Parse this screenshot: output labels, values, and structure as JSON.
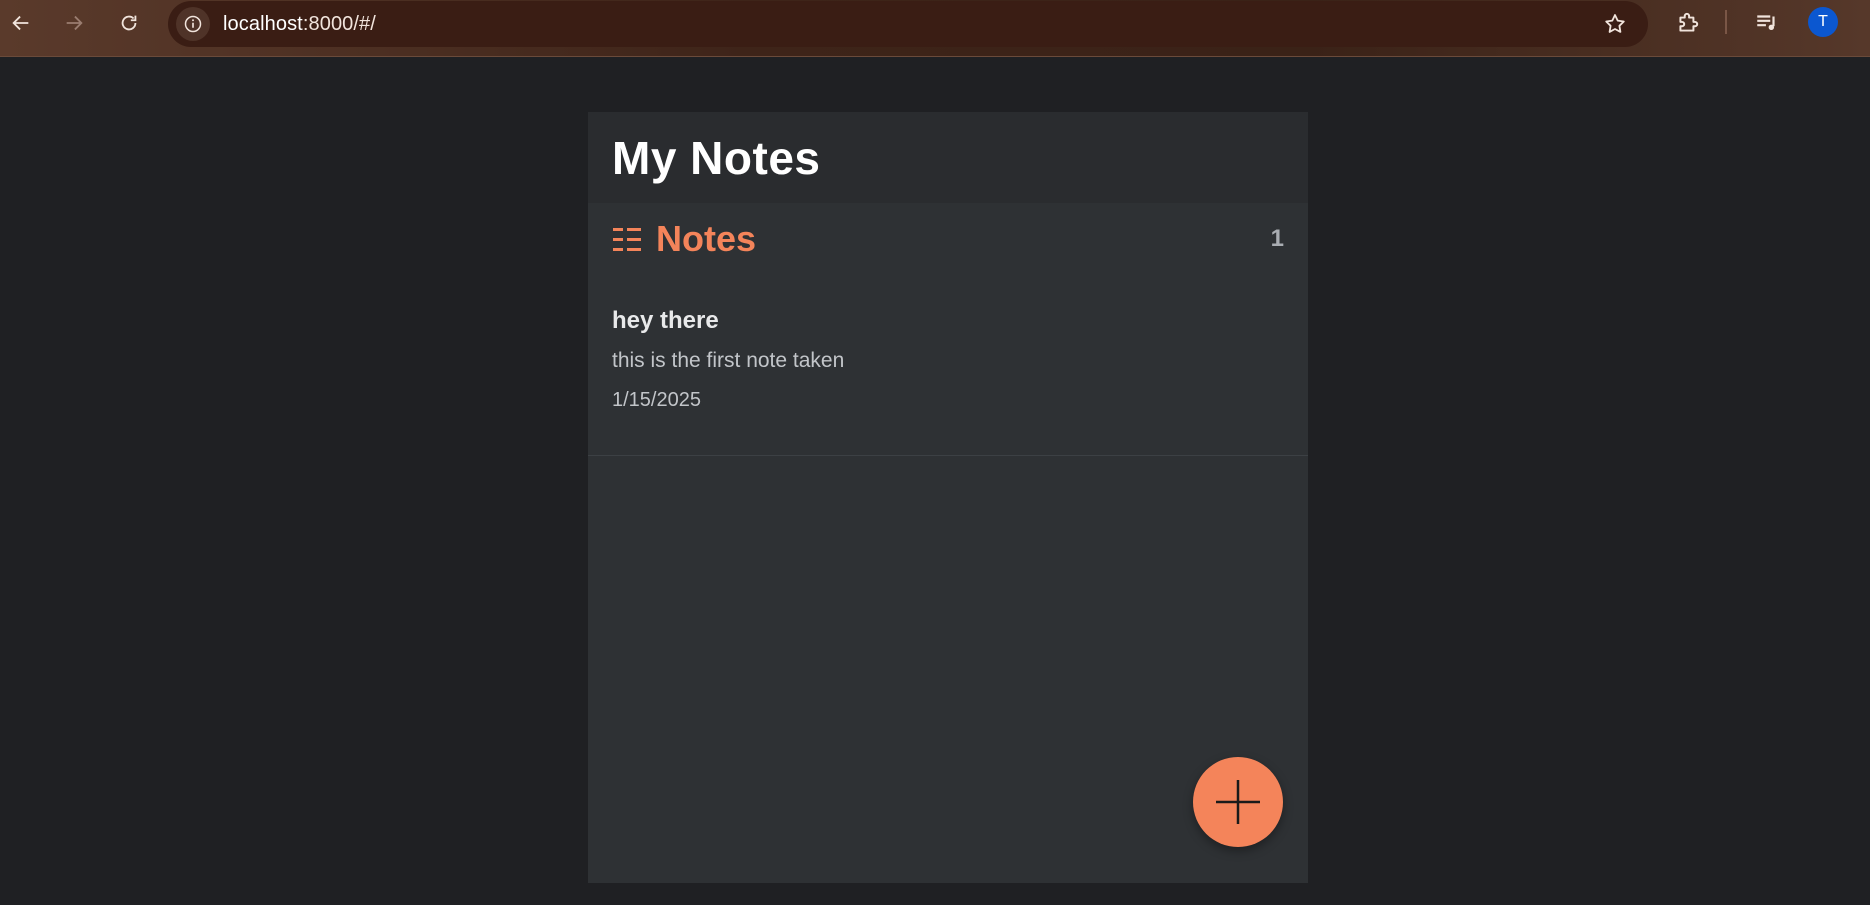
{
  "browser": {
    "url_host": "localhost",
    "url_rest": ":8000/#/",
    "profile_initial": "T",
    "icons": {
      "back": "arrow-left-icon",
      "forward": "arrow-right-icon",
      "reload": "reload-icon",
      "site_info": "info-icon",
      "bookmark": "star-icon",
      "extensions": "puzzle-icon",
      "media": "media-queue-icon"
    }
  },
  "app": {
    "title": "My Notes",
    "section": {
      "icon": "list-icon",
      "title": "Notes",
      "count": "1"
    },
    "notes": [
      {
        "title": "hey there",
        "body": "this is the first note taken",
        "date": "1/15/2025"
      }
    ],
    "fab_icon": "plus-icon"
  },
  "colors": {
    "accent": "#f4845a",
    "page_bg": "#1f2023",
    "panel_bg": "#2e3134",
    "header_bg": "#2a2c2f"
  }
}
